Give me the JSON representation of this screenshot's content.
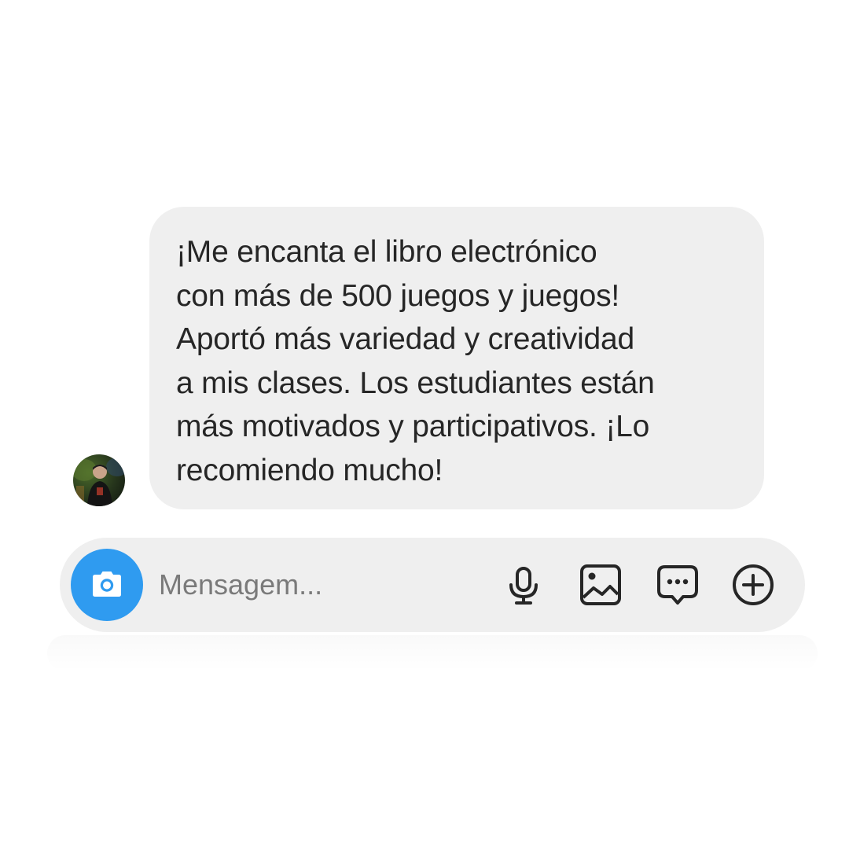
{
  "message": {
    "lines": [
      "¡Me encanta el libro electrónico",
      "con más de 500 juegos y juegos!",
      "Aportó más variedad y creatividad",
      "a mis clases. Los estudiantes están",
      "más motivados y participativos. ¡Lo",
      "recomiendo mucho!"
    ]
  },
  "composer": {
    "placeholder": "Mensagem...",
    "value": ""
  },
  "colors": {
    "bubble_bg": "#efefef",
    "composer_bg": "#efefef",
    "camera_accent": "#2f9bf0",
    "text": "#262626",
    "placeholder": "#7a7a7a"
  },
  "icons": {
    "camera": "camera-icon",
    "mic": "microphone-icon",
    "gallery": "image-gallery-icon",
    "sticker": "sticker-chat-icon",
    "more": "plus-circle-icon"
  }
}
